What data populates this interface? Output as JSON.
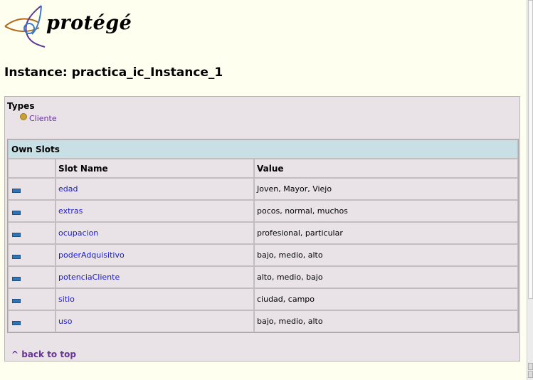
{
  "logo": {
    "text": "protégé"
  },
  "instance": {
    "title": "Instance: practica_ic_Instance_1"
  },
  "types": {
    "label": "Types",
    "items": [
      {
        "label": "Cliente"
      }
    ]
  },
  "own_slots": {
    "header": "Own Slots",
    "columns": {
      "name": "Slot Name",
      "value": "Value"
    },
    "rows": [
      {
        "name": "edad",
        "value": "Joven, Mayor, Viejo"
      },
      {
        "name": "extras",
        "value": "pocos, normal, muchos"
      },
      {
        "name": "ocupacion",
        "value": "profesional, particular"
      },
      {
        "name": "poderAdquisitivo",
        "value": "bajo, medio, alto"
      },
      {
        "name": "potenciaCliente",
        "value": "alto, medio, bajo"
      },
      {
        "name": "sitio",
        "value": "ciudad, campo"
      },
      {
        "name": "uso",
        "value": "bajo, medio, alto"
      }
    ]
  },
  "footer": {
    "back_to_top": "^ back to top"
  },
  "colors": {
    "page_bg": "#fffff0",
    "panel_bg": "#e9e3e7",
    "header_bg": "#c8dfe6",
    "link": "#1a1acc",
    "visited_link": "#663399"
  },
  "icons": {
    "type": "class-bullet-icon",
    "slot": "slot-icon"
  }
}
